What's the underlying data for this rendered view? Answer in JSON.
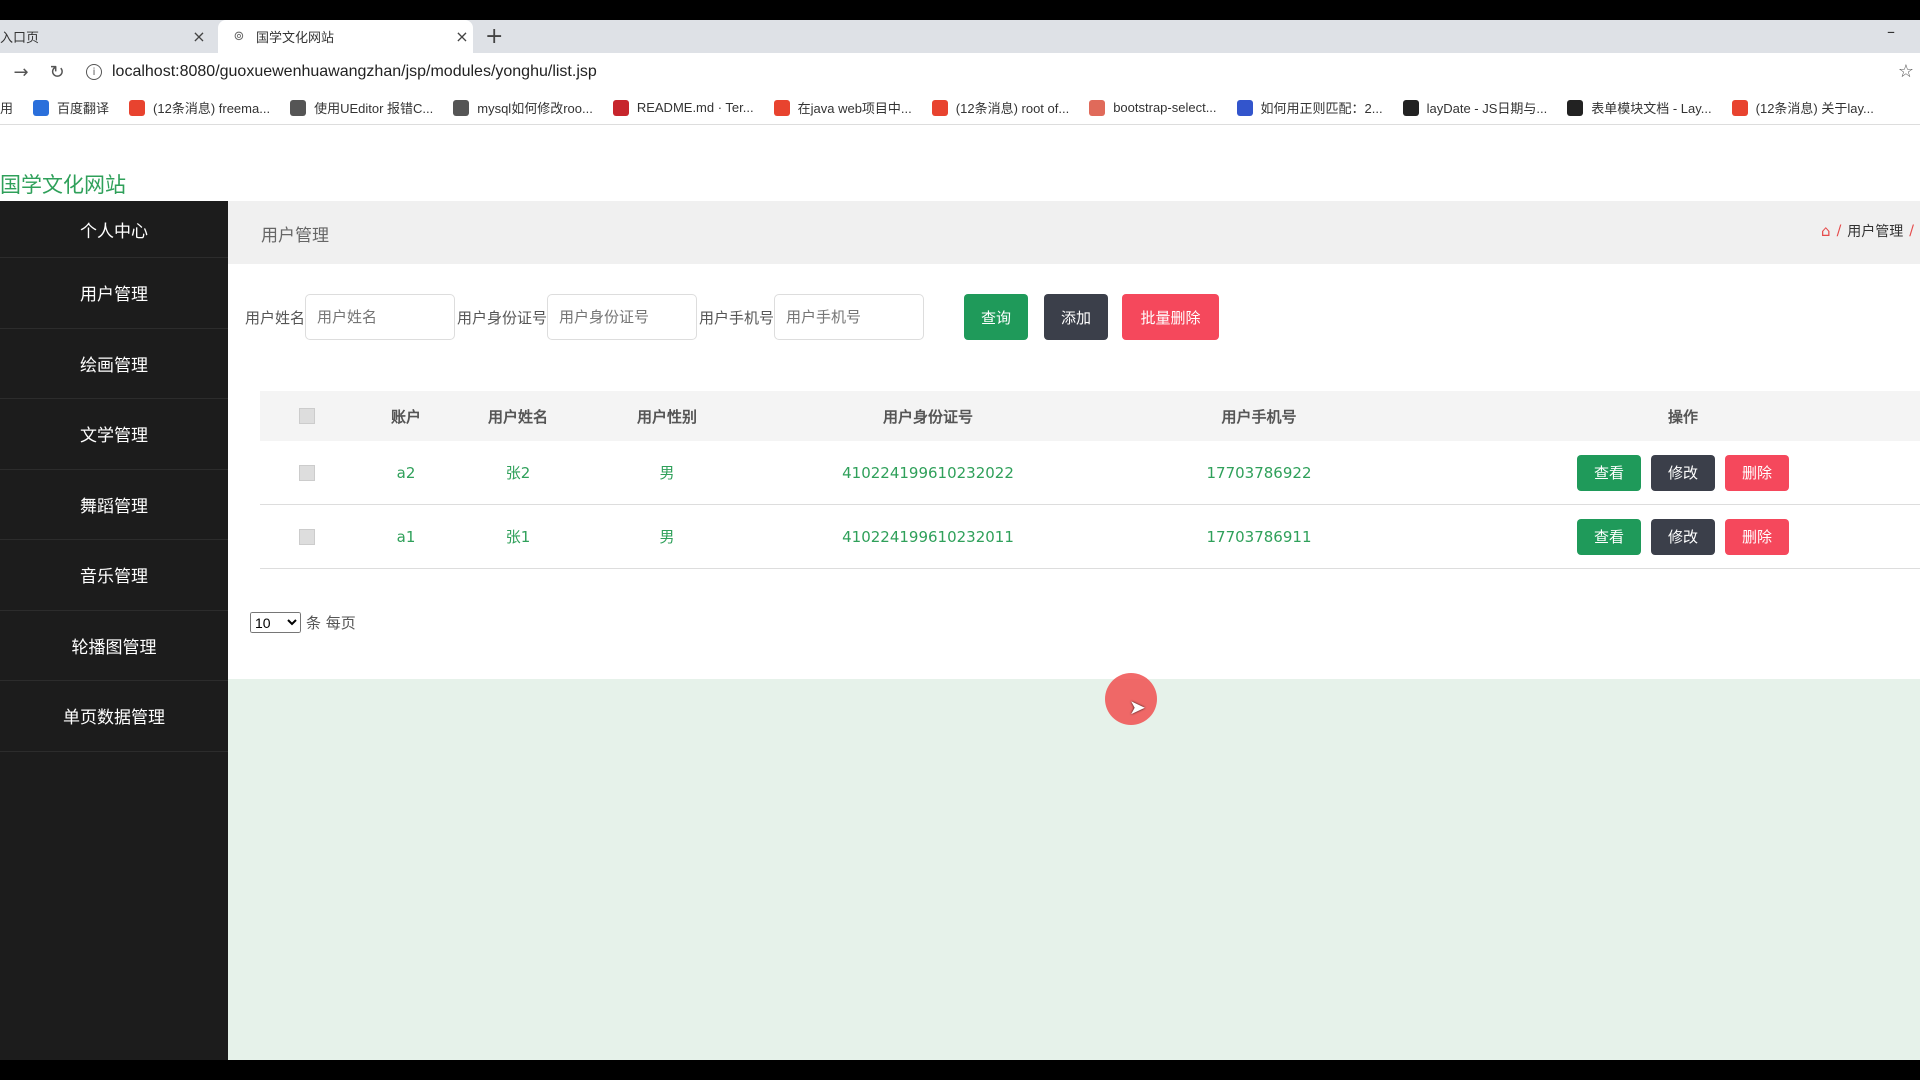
{
  "browser": {
    "tabs": [
      {
        "title": "入口页",
        "close": "×"
      },
      {
        "title": "国学文化网站",
        "close": "×"
      }
    ],
    "new_tab": "+",
    "minimize": "–",
    "url": "localhost:8080/guoxuewenhuawangzhan/jsp/modules/yonghu/list.jsp",
    "bookmarks": [
      {
        "label": "用",
        "icon_color": "#ffffff"
      },
      {
        "label": "百度翻译",
        "icon_color": "#2a6fdb"
      },
      {
        "label": "(12条消息) freema...",
        "icon_color": "#e8432f"
      },
      {
        "label": "使用UEditor 报错C...",
        "icon_color": "#555555"
      },
      {
        "label": "mysql如何修改roo...",
        "icon_color": "#555555"
      },
      {
        "label": "README.md · Ter...",
        "icon_color": "#c7252c"
      },
      {
        "label": "在java web项目中...",
        "icon_color": "#e8432f"
      },
      {
        "label": "(12条消息) root of...",
        "icon_color": "#e8432f"
      },
      {
        "label": "bootstrap-select...",
        "icon_color": "#e06a5a"
      },
      {
        "label": "如何用正则匹配：2...",
        "icon_color": "#3355cc"
      },
      {
        "label": "layDate - JS日期与...",
        "icon_color": "#222222"
      },
      {
        "label": "表单模块文档 - Lay...",
        "icon_color": "#222222"
      },
      {
        "label": "(12条消息) 关于lay...",
        "icon_color": "#e8432f"
      }
    ]
  },
  "site": {
    "title": "国学文化网站",
    "accent": "#21a04c"
  },
  "sidebar": {
    "items": [
      {
        "label": "个人中心"
      },
      {
        "label": "用户管理"
      },
      {
        "label": "绘画管理"
      },
      {
        "label": "文学管理"
      },
      {
        "label": "舞蹈管理"
      },
      {
        "label": "音乐管理"
      },
      {
        "label": "轮播图管理"
      },
      {
        "label": "单页数据管理"
      }
    ]
  },
  "page": {
    "title": "用户管理",
    "breadcrumb": {
      "home_sep": "/",
      "current": "用户管理",
      "tail": "/"
    }
  },
  "search": {
    "name_label": "用户姓名",
    "name_placeholder": "用户姓名",
    "idcard_label": "用户身份证号",
    "idcard_placeholder": "用户身份证号",
    "phone_label": "用户手机号",
    "phone_placeholder": "用户手机号",
    "query_label": "查询",
    "add_label": "添加",
    "bulk_delete_label": "批量删除"
  },
  "table": {
    "headers": {
      "account": "账户",
      "name": "用户姓名",
      "gender": "用户性别",
      "idcard": "用户身份证号",
      "phone": "用户手机号",
      "actions": "操作"
    },
    "rows": [
      {
        "account": "a2",
        "name": "张2",
        "gender": "男",
        "idcard": "410224199610232022",
        "phone": "17703786922"
      },
      {
        "account": "a1",
        "name": "张1",
        "gender": "男",
        "idcard": "410224199610232011",
        "phone": "17703786911"
      }
    ],
    "actions": {
      "view": "查看",
      "edit": "修改",
      "delete": "删除"
    }
  },
  "pager": {
    "page_size": "10",
    "suffix": "条 每页"
  }
}
